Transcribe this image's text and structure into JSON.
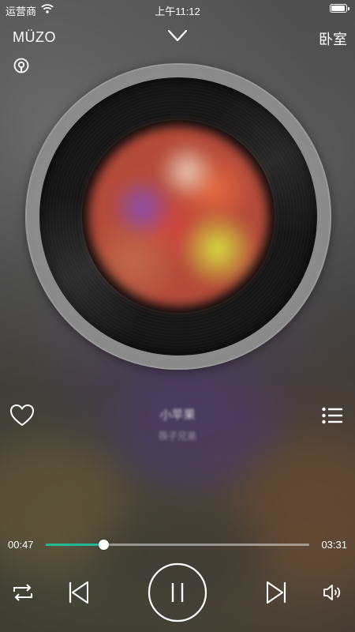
{
  "status_bar": {
    "carrier": "运营商",
    "time": "上午11:12",
    "battery_level": 0.95
  },
  "nav": {
    "brand": "MÜZO",
    "room": "卧室"
  },
  "song": {
    "title": "小苹果",
    "artist": "筷子兄弟"
  },
  "progress": {
    "current": "00:47",
    "total": "03:31",
    "fraction": 0.22
  },
  "colors": {
    "accent": "#22b898"
  },
  "icons": {
    "wifi": "wifi-icon",
    "battery": "battery-icon",
    "collapse": "chevron-down-icon",
    "cast": "podcast-icon",
    "favorite": "heart-icon",
    "queue": "playlist-icon",
    "repeat": "repeat-icon",
    "previous": "skip-previous-icon",
    "play_pause": "pause-icon",
    "next": "skip-next-icon",
    "volume": "volume-icon"
  }
}
